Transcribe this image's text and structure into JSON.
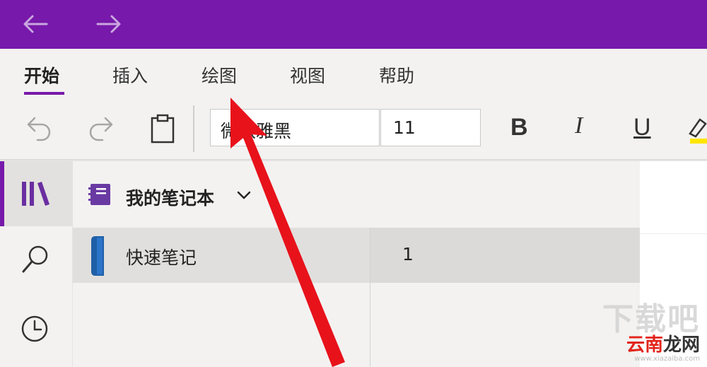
{
  "colors": {
    "accent": "#7719aa",
    "arrow": "#e8121b",
    "notebook_icon": "#6a3aa3",
    "section_tab": "#1f5fa8"
  },
  "nav": {
    "back_icon": "arrow-left-icon",
    "forward_icon": "arrow-right-icon"
  },
  "tabs": [
    {
      "label": "开始",
      "active": true
    },
    {
      "label": "插入",
      "active": false
    },
    {
      "label": "绘图",
      "active": false
    },
    {
      "label": "视图",
      "active": false
    },
    {
      "label": "帮助",
      "active": false
    }
  ],
  "toolbar": {
    "font_name": "微软雅黑",
    "font_size": "11",
    "bold_label": "B",
    "italic_label": "I",
    "underline_label": "U"
  },
  "notebook": {
    "title": "我的笔记本",
    "section": "快速笔记",
    "page": "1"
  },
  "watermark": {
    "big": "下载吧",
    "brand_part1": "云南",
    "brand_part2": "龙网",
    "url": "www.xiazaiba.com"
  }
}
